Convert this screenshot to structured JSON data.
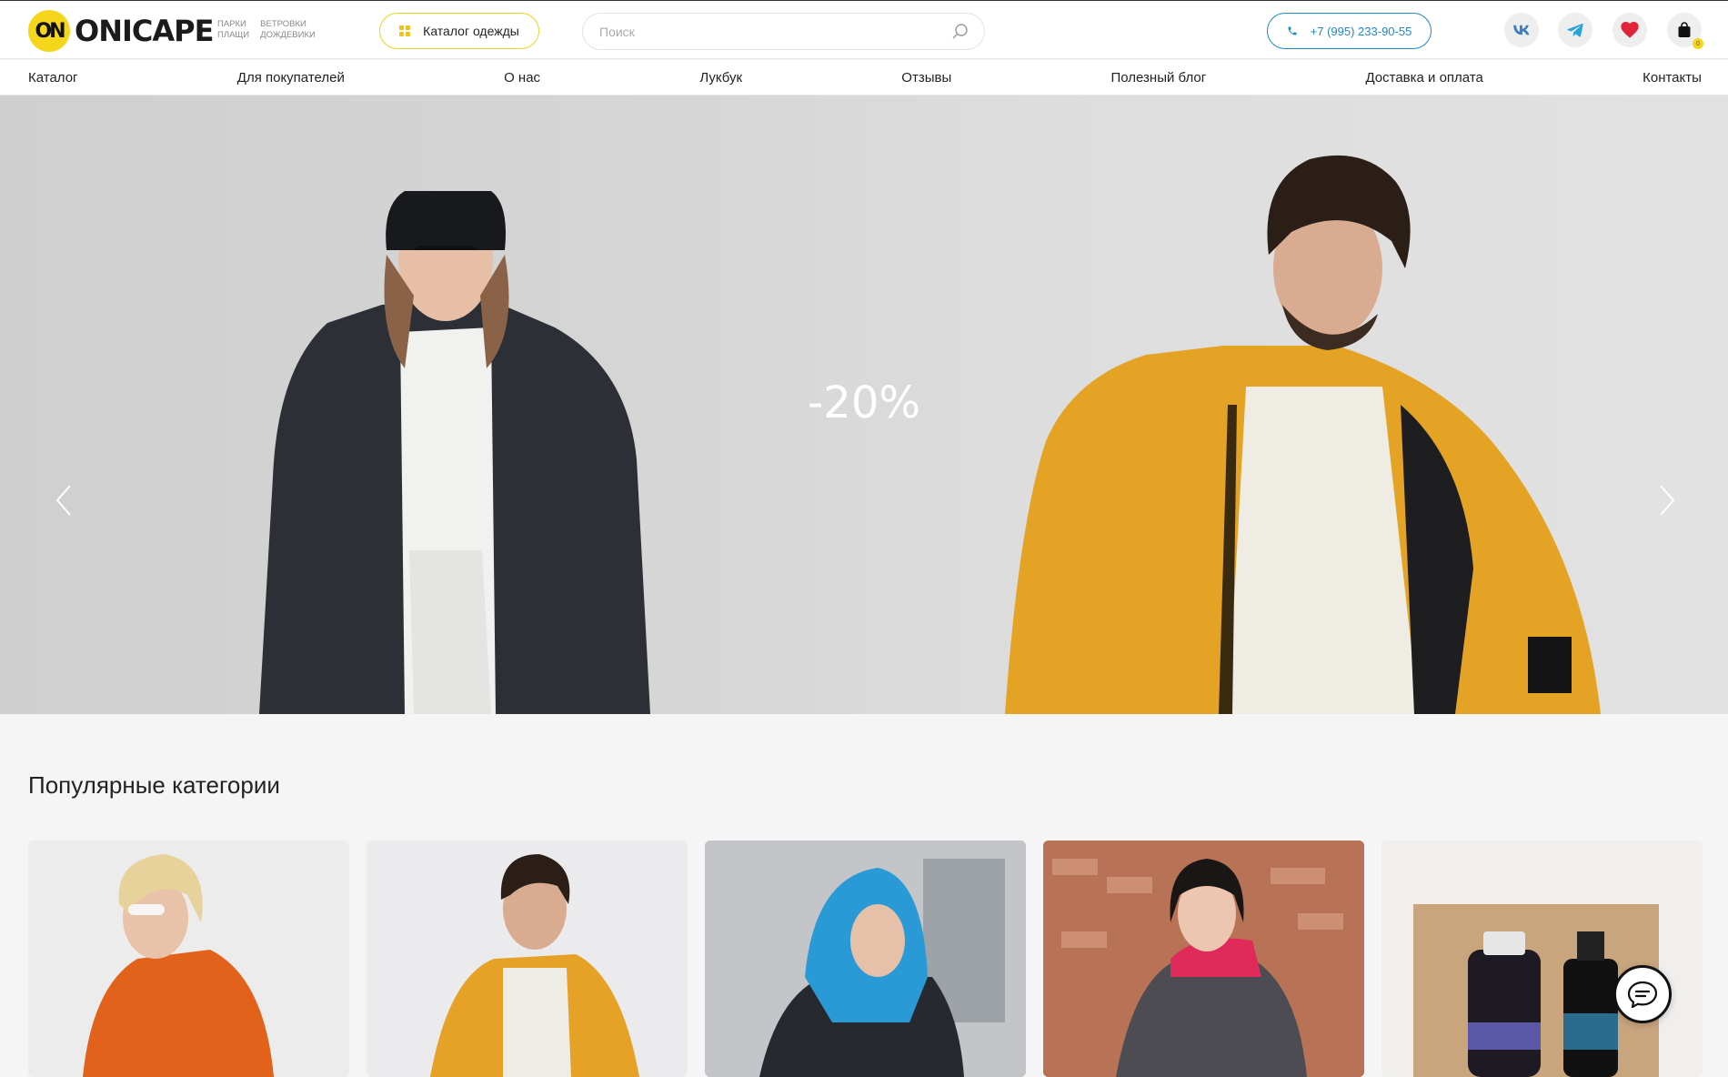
{
  "header": {
    "logo_mark": "ON",
    "logo_text": "ONICAPE",
    "logo_tags": [
      "ПАРКИ",
      "ВЕТРОВКИ",
      "ПЛАЩИ",
      "ДОЖДЕВИКИ"
    ],
    "catalog_button": "Каталог одежды",
    "search_placeholder": "Поиск",
    "phone": "+7 (995) 233-90-55",
    "cart_count": "0",
    "icons": [
      "grid-icon",
      "search-icon",
      "phone-icon",
      "vk-icon",
      "telegram-icon",
      "heart-icon",
      "cart-icon"
    ]
  },
  "nav": {
    "items": [
      "Каталог",
      "Для покупателей",
      "О нас",
      "Лукбук",
      "Отзывы",
      "Полезный блог",
      "Доставка и оплата",
      "Контакты"
    ]
  },
  "hero": {
    "promo": "-20%"
  },
  "popular": {
    "title": "Популярные категории"
  },
  "colors": {
    "brand_yellow": "#f5d61c",
    "phone_blue": "#1e88c9",
    "heart_red": "#e0243a"
  }
}
